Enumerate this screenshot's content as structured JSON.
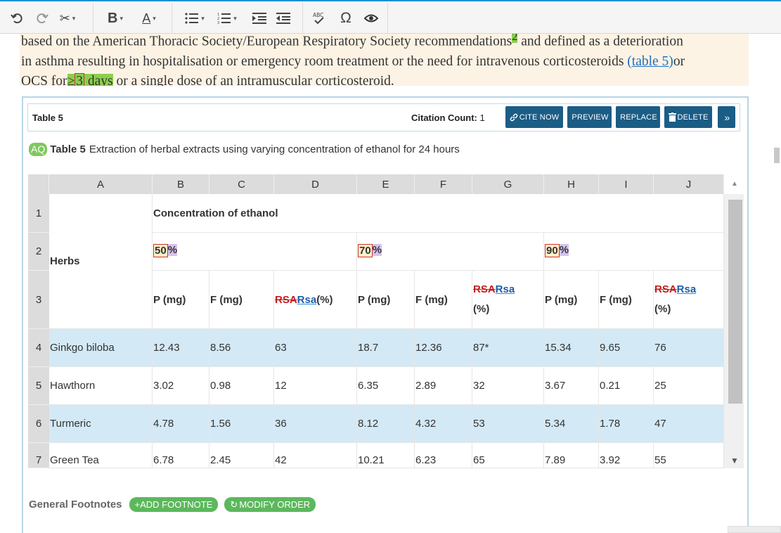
{
  "paragraph": {
    "line1": "based on the American Thoracic Society/European Respiratory Society recommendations",
    "line1_ref": "2",
    "line1_end": " and defined as a deterioration",
    "line2_start": "in asthma resulting in hospitalisation or emergency room treatment or the need for intravenous corticosteroids ",
    "line2_link": "(table 5)",
    "line2_end": "or",
    "line3_start": "OCS for",
    "line3_ge": "≥",
    "line3_num": "3",
    "line3_days": " days",
    "line3_end": " or a single dose of an intramuscular corticosteroid."
  },
  "panel": {
    "title": "Table 5",
    "citation_label": "Citation Count:",
    "citation_value": "1",
    "buttons": {
      "cite": "CITE NOW",
      "preview": "PREVIEW",
      "replace": "REPLACE",
      "delete": "DELETE"
    }
  },
  "caption": {
    "aq": "AQ",
    "label": "Table 5",
    "text": "Extraction of herbal extracts using varying concentration of ethanol for 24 hours"
  },
  "grid": {
    "columns": [
      "A",
      "B",
      "C",
      "D",
      "E",
      "F",
      "G",
      "H",
      "I",
      "J"
    ],
    "row_numbers": [
      "1",
      "2",
      "3",
      "4",
      "5",
      "6",
      "7"
    ],
    "herbs_header": "Herbs",
    "concentration_header": "Concentration of ethanol",
    "pct": {
      "p50": "50",
      "p70": "70",
      "p90": "90",
      "sign": "%"
    },
    "sub": {
      "p": "P (mg)",
      "f": "F (mg)",
      "rsa_old": "RSA",
      "rsa_new": "Rsa",
      "rsa_unit": " (%)",
      "rsa_unit2": "(%)"
    },
    "rows": [
      {
        "herb": "Ginkgo biloba",
        "v": [
          "12.43",
          "8.56",
          "63",
          "18.7",
          "12.36",
          "87*",
          "15.34",
          "9.65",
          "76"
        ]
      },
      {
        "herb": "Hawthorn",
        "v": [
          "3.02",
          "0.98",
          "12",
          "6.35",
          "2.89",
          "32",
          "3.67",
          "0.21",
          "25"
        ]
      },
      {
        "herb": "Turmeric",
        "v": [
          "4.78",
          "1.56",
          "36",
          "8.12",
          "4.32",
          "53",
          "5.34",
          "1.78",
          "47"
        ]
      },
      {
        "herb": "Green Tea",
        "v": [
          "6.78",
          "2.45",
          "42",
          "10.21",
          "6.23",
          "65",
          "7.89",
          "3.92",
          "55"
        ]
      }
    ]
  },
  "footnotes": {
    "label": "General Footnotes",
    "add": "+ADD FOOTNOTE",
    "modify": "MODIFY ORDER"
  }
}
